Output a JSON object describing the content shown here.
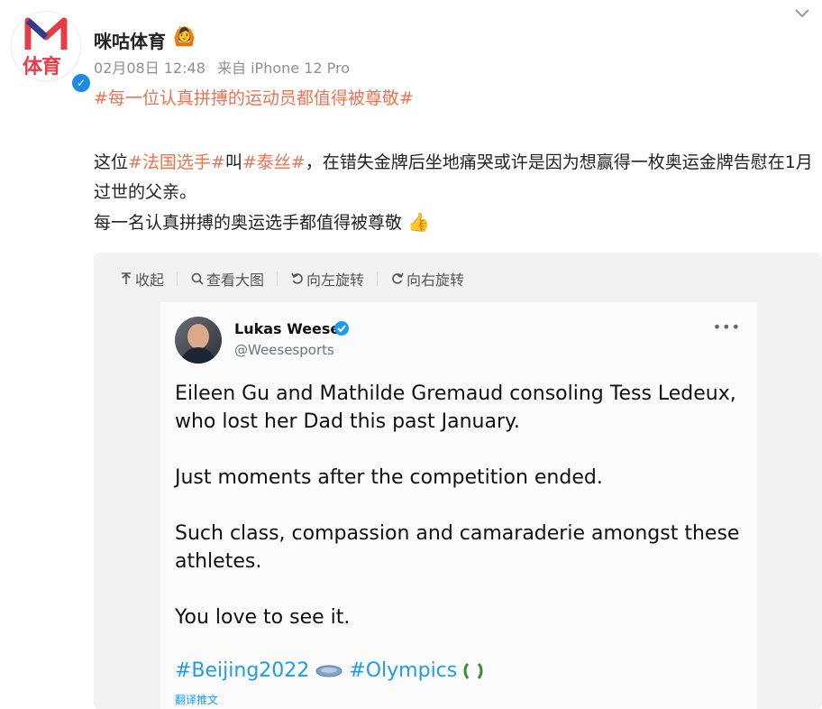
{
  "post": {
    "avatar_logo_text": "体育",
    "username": "咪咕体育",
    "username_badge": "🙆",
    "date": "02月08日 12:48",
    "source": "来自 iPhone 12 Pro",
    "hashtag_title": "#每一位认真拼搏的运动员都值得被尊敬#",
    "text_1": "这位",
    "tag_1": "#法国选手#",
    "text_2": "叫",
    "tag_2": "#泰丝#",
    "text_3": "，在错失金牌后坐地痛哭或许是因为想赢得一枚奥运金牌告慰在1月过世的父亲。",
    "text_4": "每一名认真拼搏的奥运选手都值得被尊敬",
    "thumb_emoji": "👍"
  },
  "toolbar": {
    "collapse_label": "收起",
    "view_large_label": "查看大图",
    "rotate_left_label": "向左旋转",
    "rotate_right_label": "向右旋转"
  },
  "tweet": {
    "name": "Lukas Weese",
    "handle": "@Weesesports",
    "more_label": "•••",
    "paragraphs": [
      "Eileen Gu and Mathilde Gremaud consoling Tess Ledeux, who lost her Dad this past January.",
      "Just moments after the competition ended.",
      "Such class, compassion and camaraderie amongst these athletes.",
      "You love to see it."
    ],
    "hashtag_1": "#Beijing2022",
    "hashtag_2": "#Olympics",
    "translate_label": "翻译推文"
  },
  "colors": {
    "accent_orange": "#eb7350",
    "brand_red": "#e43d45",
    "twitter_blue": "#1d9bf0",
    "verified_blue": "#1f8ae5"
  },
  "icons": [
    "chevron-down-icon",
    "verified-icon",
    "collapse-icon",
    "search-icon",
    "rotate-left-icon",
    "rotate-right-icon",
    "more-icon"
  ]
}
